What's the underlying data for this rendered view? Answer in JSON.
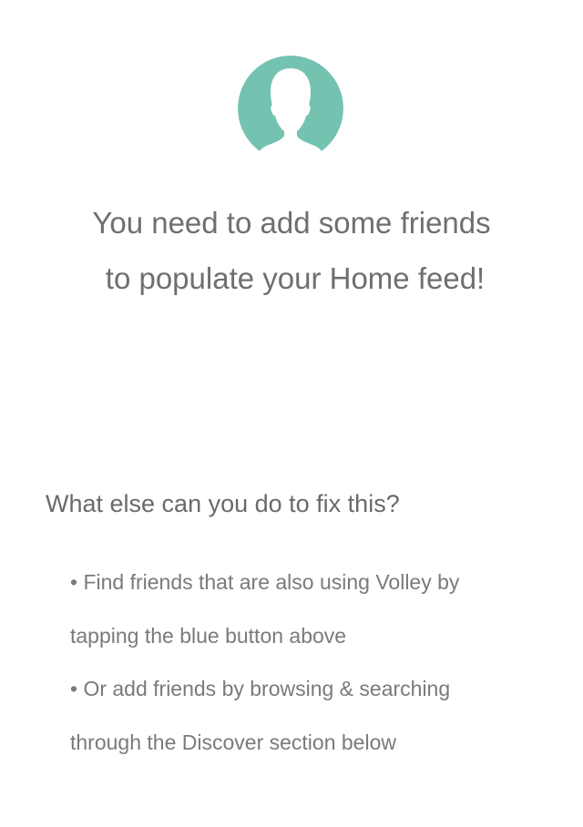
{
  "avatar": {
    "icon": "person-silhouette-icon",
    "background_color": "#74c3b0"
  },
  "headline": {
    "line1": "You need to add some friends",
    "line2": "to populate your Home feed!"
  },
  "help": {
    "title": "What else can you do to fix this?",
    "tips": [
      {
        "line1": "• Find friends that are also using Volley by",
        "line2": "tapping the blue button above"
      },
      {
        "line1": "• Or add friends by browsing & searching",
        "line2": "through the Discover section below"
      }
    ]
  }
}
